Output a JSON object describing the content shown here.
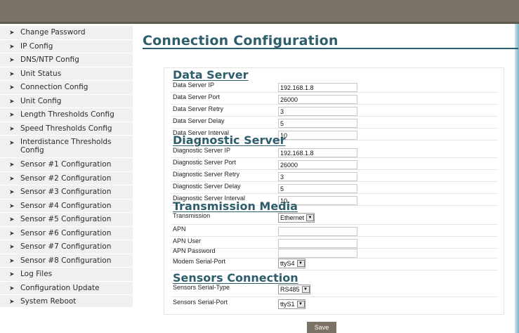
{
  "sidebar": {
    "items": [
      {
        "label": "Change Password"
      },
      {
        "label": "IP Config"
      },
      {
        "label": "DNS/NTP Config"
      },
      {
        "label": "Unit Status"
      },
      {
        "label": "Connection Config"
      },
      {
        "label": "Unit Config"
      },
      {
        "label": "Length Thresholds Config"
      },
      {
        "label": "Speed Thresholds Config"
      },
      {
        "label": "Interdistance Thresholds Config"
      },
      {
        "label": "Sensor #1 Configuration"
      },
      {
        "label": "Sensor #2 Configuration"
      },
      {
        "label": "Sensor #3 Configuration"
      },
      {
        "label": "Sensor #4 Configuration"
      },
      {
        "label": "Sensor #5 Configuration"
      },
      {
        "label": "Sensor #6 Configuration"
      },
      {
        "label": "Sensor #7 Configuration"
      },
      {
        "label": "Sensor #8 Configuration"
      },
      {
        "label": "Log Files"
      },
      {
        "label": "Configuration Update"
      },
      {
        "label": "System Reboot"
      }
    ]
  },
  "page": {
    "title": "Connection Configuration"
  },
  "data_server": {
    "title": "Data Server",
    "ip_label": "Data Server IP",
    "ip_value": "192.168.1.8",
    "port_label": "Data Server Port",
    "port_value": "26000",
    "retry_label": "Data Server Retry",
    "retry_value": "3",
    "delay_label": "Data Server Delay",
    "delay_value": "5",
    "interval_label": "Data Server Interval",
    "interval_value": "10"
  },
  "diagnostic_server": {
    "title": "Diagnostic Server",
    "ip_label": "Diagnostic Server IP",
    "ip_value": "192.168.1.8",
    "port_label": "Diagnostic Server Port",
    "port_value": "26000",
    "retry_label": "Diagnostic Server Retry",
    "retry_value": "3",
    "delay_label": "Diagnostic Server Delay",
    "delay_value": "5",
    "interval_label": "Diagnostic Server Interval",
    "interval_value": "10"
  },
  "transmission_media": {
    "title": "Transmission Media",
    "transmission_label": "Transmission",
    "transmission_value": "Ethernet",
    "apn_label": "APN",
    "apn_value": "",
    "apn_user_label": "APN User",
    "apn_user_value": "",
    "apn_password_label": "APN Password",
    "apn_password_value": "",
    "modem_port_label": "Modem Serial-Port",
    "modem_port_value": "ttyS4"
  },
  "sensors_connection": {
    "title": "Sensors Connection",
    "serial_type_label": "Sensors Serial-Type",
    "serial_type_value": "RS485",
    "serial_port_label": "Sensors Serial-Port",
    "serial_port_value": "ttyS1"
  },
  "actions": {
    "save_label": "Save"
  },
  "colors": {
    "header_bar": "#7a7365",
    "accent": "#2e5e6b",
    "sidebar_bg": "#f0f0ef"
  }
}
